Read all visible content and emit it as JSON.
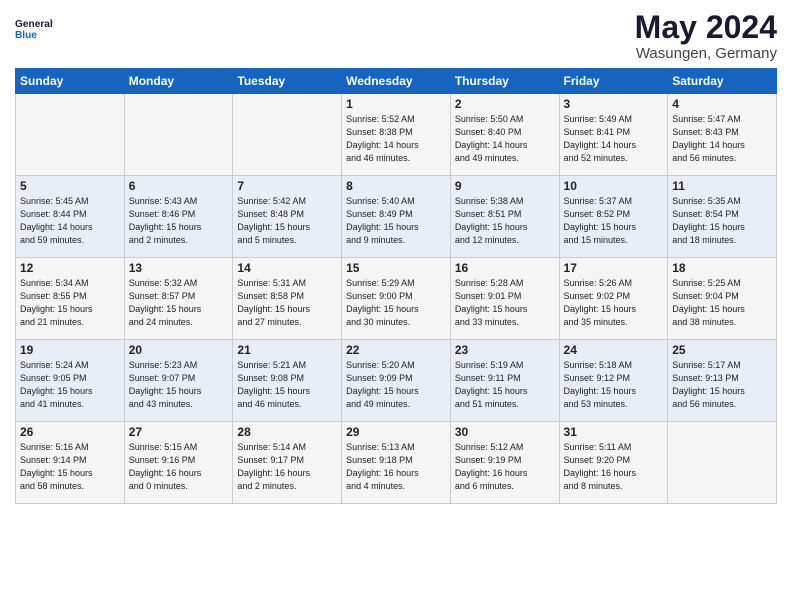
{
  "logo": {
    "line1": "General",
    "line2": "Blue"
  },
  "title": "May 2024",
  "location": "Wasungen, Germany",
  "header_days": [
    "Sunday",
    "Monday",
    "Tuesday",
    "Wednesday",
    "Thursday",
    "Friday",
    "Saturday"
  ],
  "weeks": [
    [
      {
        "day": "",
        "content": ""
      },
      {
        "day": "",
        "content": ""
      },
      {
        "day": "",
        "content": ""
      },
      {
        "day": "1",
        "content": "Sunrise: 5:52 AM\nSunset: 8:38 PM\nDaylight: 14 hours\nand 46 minutes."
      },
      {
        "day": "2",
        "content": "Sunrise: 5:50 AM\nSunset: 8:40 PM\nDaylight: 14 hours\nand 49 minutes."
      },
      {
        "day": "3",
        "content": "Sunrise: 5:49 AM\nSunset: 8:41 PM\nDaylight: 14 hours\nand 52 minutes."
      },
      {
        "day": "4",
        "content": "Sunrise: 5:47 AM\nSunset: 8:43 PM\nDaylight: 14 hours\nand 56 minutes."
      }
    ],
    [
      {
        "day": "5",
        "content": "Sunrise: 5:45 AM\nSunset: 8:44 PM\nDaylight: 14 hours\nand 59 minutes."
      },
      {
        "day": "6",
        "content": "Sunrise: 5:43 AM\nSunset: 8:46 PM\nDaylight: 15 hours\nand 2 minutes."
      },
      {
        "day": "7",
        "content": "Sunrise: 5:42 AM\nSunset: 8:48 PM\nDaylight: 15 hours\nand 5 minutes."
      },
      {
        "day": "8",
        "content": "Sunrise: 5:40 AM\nSunset: 8:49 PM\nDaylight: 15 hours\nand 9 minutes."
      },
      {
        "day": "9",
        "content": "Sunrise: 5:38 AM\nSunset: 8:51 PM\nDaylight: 15 hours\nand 12 minutes."
      },
      {
        "day": "10",
        "content": "Sunrise: 5:37 AM\nSunset: 8:52 PM\nDaylight: 15 hours\nand 15 minutes."
      },
      {
        "day": "11",
        "content": "Sunrise: 5:35 AM\nSunset: 8:54 PM\nDaylight: 15 hours\nand 18 minutes."
      }
    ],
    [
      {
        "day": "12",
        "content": "Sunrise: 5:34 AM\nSunset: 8:55 PM\nDaylight: 15 hours\nand 21 minutes."
      },
      {
        "day": "13",
        "content": "Sunrise: 5:32 AM\nSunset: 8:57 PM\nDaylight: 15 hours\nand 24 minutes."
      },
      {
        "day": "14",
        "content": "Sunrise: 5:31 AM\nSunset: 8:58 PM\nDaylight: 15 hours\nand 27 minutes."
      },
      {
        "day": "15",
        "content": "Sunrise: 5:29 AM\nSunset: 9:00 PM\nDaylight: 15 hours\nand 30 minutes."
      },
      {
        "day": "16",
        "content": "Sunrise: 5:28 AM\nSunset: 9:01 PM\nDaylight: 15 hours\nand 33 minutes."
      },
      {
        "day": "17",
        "content": "Sunrise: 5:26 AM\nSunset: 9:02 PM\nDaylight: 15 hours\nand 35 minutes."
      },
      {
        "day": "18",
        "content": "Sunrise: 5:25 AM\nSunset: 9:04 PM\nDaylight: 15 hours\nand 38 minutes."
      }
    ],
    [
      {
        "day": "19",
        "content": "Sunrise: 5:24 AM\nSunset: 9:05 PM\nDaylight: 15 hours\nand 41 minutes."
      },
      {
        "day": "20",
        "content": "Sunrise: 5:23 AM\nSunset: 9:07 PM\nDaylight: 15 hours\nand 43 minutes."
      },
      {
        "day": "21",
        "content": "Sunrise: 5:21 AM\nSunset: 9:08 PM\nDaylight: 15 hours\nand 46 minutes."
      },
      {
        "day": "22",
        "content": "Sunrise: 5:20 AM\nSunset: 9:09 PM\nDaylight: 15 hours\nand 49 minutes."
      },
      {
        "day": "23",
        "content": "Sunrise: 5:19 AM\nSunset: 9:11 PM\nDaylight: 15 hours\nand 51 minutes."
      },
      {
        "day": "24",
        "content": "Sunrise: 5:18 AM\nSunset: 9:12 PM\nDaylight: 15 hours\nand 53 minutes."
      },
      {
        "day": "25",
        "content": "Sunrise: 5:17 AM\nSunset: 9:13 PM\nDaylight: 15 hours\nand 56 minutes."
      }
    ],
    [
      {
        "day": "26",
        "content": "Sunrise: 5:16 AM\nSunset: 9:14 PM\nDaylight: 15 hours\nand 58 minutes."
      },
      {
        "day": "27",
        "content": "Sunrise: 5:15 AM\nSunset: 9:16 PM\nDaylight: 16 hours\nand 0 minutes."
      },
      {
        "day": "28",
        "content": "Sunrise: 5:14 AM\nSunset: 9:17 PM\nDaylight: 16 hours\nand 2 minutes."
      },
      {
        "day": "29",
        "content": "Sunrise: 5:13 AM\nSunset: 9:18 PM\nDaylight: 16 hours\nand 4 minutes."
      },
      {
        "day": "30",
        "content": "Sunrise: 5:12 AM\nSunset: 9:19 PM\nDaylight: 16 hours\nand 6 minutes."
      },
      {
        "day": "31",
        "content": "Sunrise: 5:11 AM\nSunset: 9:20 PM\nDaylight: 16 hours\nand 8 minutes."
      },
      {
        "day": "",
        "content": ""
      }
    ]
  ]
}
